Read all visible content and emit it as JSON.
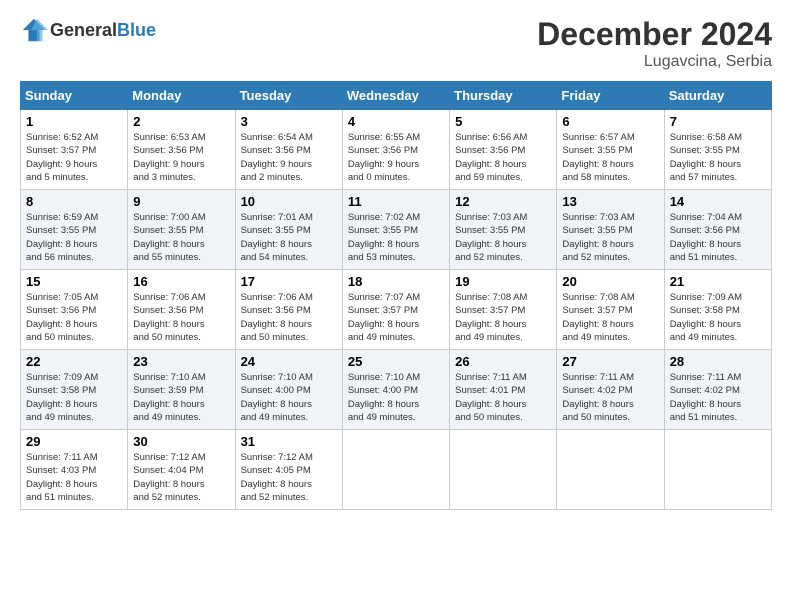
{
  "header": {
    "logo_general": "General",
    "logo_blue": "Blue",
    "month": "December 2024",
    "location": "Lugavcina, Serbia"
  },
  "weekdays": [
    "Sunday",
    "Monday",
    "Tuesday",
    "Wednesday",
    "Thursday",
    "Friday",
    "Saturday"
  ],
  "weeks": [
    [
      {
        "day": "1",
        "info": "Sunrise: 6:52 AM\nSunset: 3:57 PM\nDaylight: 9 hours\nand 5 minutes."
      },
      {
        "day": "2",
        "info": "Sunrise: 6:53 AM\nSunset: 3:56 PM\nDaylight: 9 hours\nand 3 minutes."
      },
      {
        "day": "3",
        "info": "Sunrise: 6:54 AM\nSunset: 3:56 PM\nDaylight: 9 hours\nand 2 minutes."
      },
      {
        "day": "4",
        "info": "Sunrise: 6:55 AM\nSunset: 3:56 PM\nDaylight: 9 hours\nand 0 minutes."
      },
      {
        "day": "5",
        "info": "Sunrise: 6:56 AM\nSunset: 3:56 PM\nDaylight: 8 hours\nand 59 minutes."
      },
      {
        "day": "6",
        "info": "Sunrise: 6:57 AM\nSunset: 3:55 PM\nDaylight: 8 hours\nand 58 minutes."
      },
      {
        "day": "7",
        "info": "Sunrise: 6:58 AM\nSunset: 3:55 PM\nDaylight: 8 hours\nand 57 minutes."
      }
    ],
    [
      {
        "day": "8",
        "info": "Sunrise: 6:59 AM\nSunset: 3:55 PM\nDaylight: 8 hours\nand 56 minutes."
      },
      {
        "day": "9",
        "info": "Sunrise: 7:00 AM\nSunset: 3:55 PM\nDaylight: 8 hours\nand 55 minutes."
      },
      {
        "day": "10",
        "info": "Sunrise: 7:01 AM\nSunset: 3:55 PM\nDaylight: 8 hours\nand 54 minutes."
      },
      {
        "day": "11",
        "info": "Sunrise: 7:02 AM\nSunset: 3:55 PM\nDaylight: 8 hours\nand 53 minutes."
      },
      {
        "day": "12",
        "info": "Sunrise: 7:03 AM\nSunset: 3:55 PM\nDaylight: 8 hours\nand 52 minutes."
      },
      {
        "day": "13",
        "info": "Sunrise: 7:03 AM\nSunset: 3:55 PM\nDaylight: 8 hours\nand 52 minutes."
      },
      {
        "day": "14",
        "info": "Sunrise: 7:04 AM\nSunset: 3:56 PM\nDaylight: 8 hours\nand 51 minutes."
      }
    ],
    [
      {
        "day": "15",
        "info": "Sunrise: 7:05 AM\nSunset: 3:56 PM\nDaylight: 8 hours\nand 50 minutes."
      },
      {
        "day": "16",
        "info": "Sunrise: 7:06 AM\nSunset: 3:56 PM\nDaylight: 8 hours\nand 50 minutes."
      },
      {
        "day": "17",
        "info": "Sunrise: 7:06 AM\nSunset: 3:56 PM\nDaylight: 8 hours\nand 50 minutes."
      },
      {
        "day": "18",
        "info": "Sunrise: 7:07 AM\nSunset: 3:57 PM\nDaylight: 8 hours\nand 49 minutes."
      },
      {
        "day": "19",
        "info": "Sunrise: 7:08 AM\nSunset: 3:57 PM\nDaylight: 8 hours\nand 49 minutes."
      },
      {
        "day": "20",
        "info": "Sunrise: 7:08 AM\nSunset: 3:57 PM\nDaylight: 8 hours\nand 49 minutes."
      },
      {
        "day": "21",
        "info": "Sunrise: 7:09 AM\nSunset: 3:58 PM\nDaylight: 8 hours\nand 49 minutes."
      }
    ],
    [
      {
        "day": "22",
        "info": "Sunrise: 7:09 AM\nSunset: 3:58 PM\nDaylight: 8 hours\nand 49 minutes."
      },
      {
        "day": "23",
        "info": "Sunrise: 7:10 AM\nSunset: 3:59 PM\nDaylight: 8 hours\nand 49 minutes."
      },
      {
        "day": "24",
        "info": "Sunrise: 7:10 AM\nSunset: 4:00 PM\nDaylight: 8 hours\nand 49 minutes."
      },
      {
        "day": "25",
        "info": "Sunrise: 7:10 AM\nSunset: 4:00 PM\nDaylight: 8 hours\nand 49 minutes."
      },
      {
        "day": "26",
        "info": "Sunrise: 7:11 AM\nSunset: 4:01 PM\nDaylight: 8 hours\nand 50 minutes."
      },
      {
        "day": "27",
        "info": "Sunrise: 7:11 AM\nSunset: 4:02 PM\nDaylight: 8 hours\nand 50 minutes."
      },
      {
        "day": "28",
        "info": "Sunrise: 7:11 AM\nSunset: 4:02 PM\nDaylight: 8 hours\nand 51 minutes."
      }
    ],
    [
      {
        "day": "29",
        "info": "Sunrise: 7:11 AM\nSunset: 4:03 PM\nDaylight: 8 hours\nand 51 minutes."
      },
      {
        "day": "30",
        "info": "Sunrise: 7:12 AM\nSunset: 4:04 PM\nDaylight: 8 hours\nand 52 minutes."
      },
      {
        "day": "31",
        "info": "Sunrise: 7:12 AM\nSunset: 4:05 PM\nDaylight: 8 hours\nand 52 minutes."
      },
      null,
      null,
      null,
      null
    ]
  ]
}
